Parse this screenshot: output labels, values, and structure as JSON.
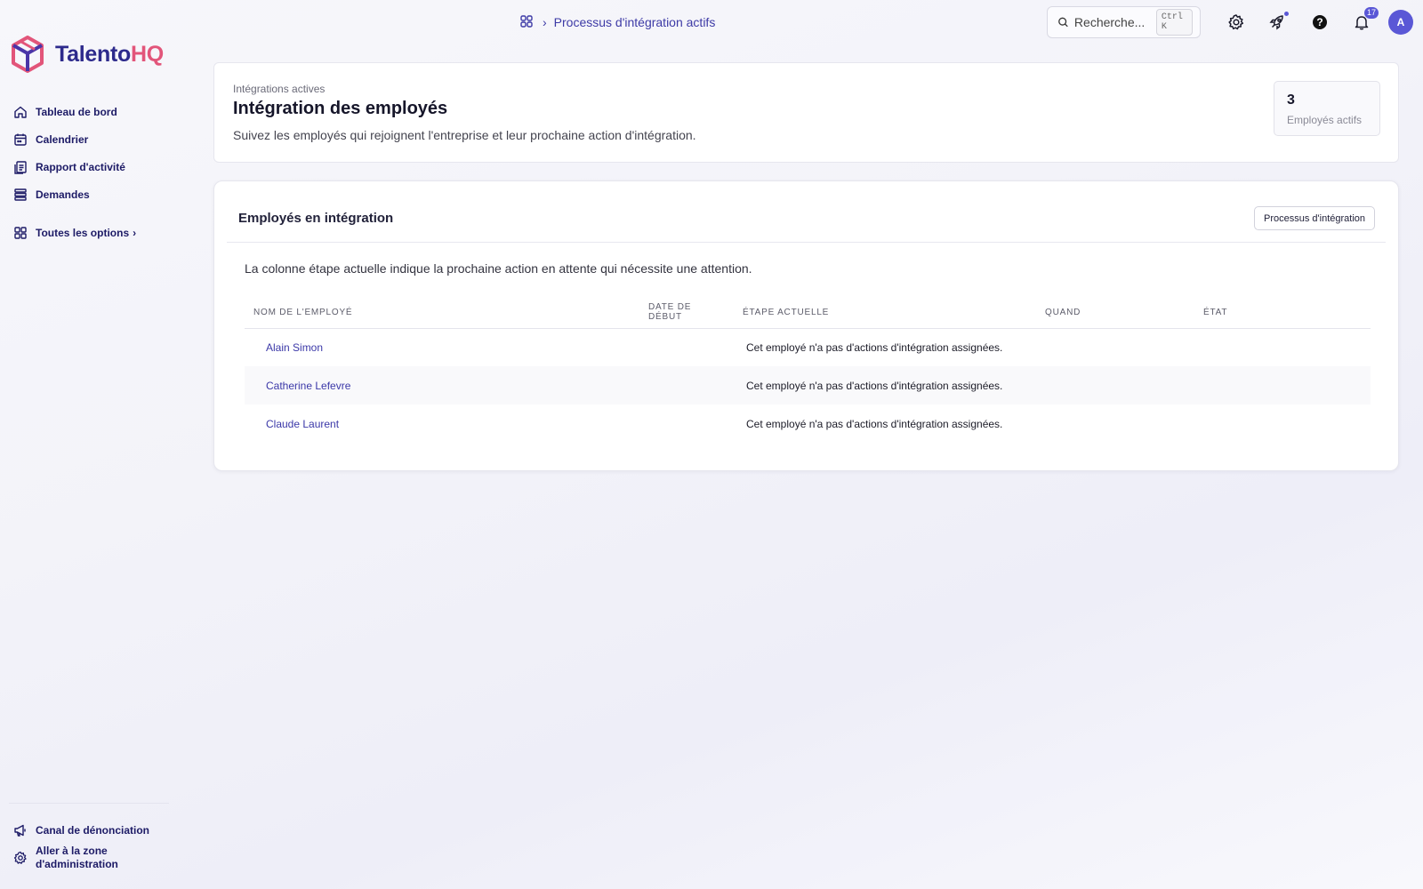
{
  "brand": {
    "name_part1": "Talento",
    "name_part2": "HQ",
    "colors": {
      "primary": "#2d2a8c",
      "accent": "#e2557a",
      "purple": "#5a57d6"
    }
  },
  "sidebar": {
    "items": [
      {
        "label": "Tableau de bord",
        "icon": "home-icon"
      },
      {
        "label": "Calendrier",
        "icon": "calendar-icon"
      },
      {
        "label": "Rapport d'activité",
        "icon": "report-icon"
      },
      {
        "label": "Demandes",
        "icon": "list-icon"
      },
      {
        "label": "Toutes les options",
        "icon": "grid-icon"
      }
    ],
    "bottom": [
      {
        "label": "Canal de dénonciation",
        "icon": "megaphone-icon"
      },
      {
        "label": "Aller à la zone d'administration",
        "icon": "gear-icon"
      }
    ]
  },
  "topbar": {
    "breadcrumb": "Processus d'intégration actifs",
    "search_placeholder": "Recherche...",
    "search_shortcut": "Ctrl K",
    "notifications_count": "17",
    "avatar_initial": "A"
  },
  "header": {
    "eyebrow": "Intégrations actives",
    "title": "Intégration des employés",
    "subtitle": "Suivez les employés qui rejoignent l'entreprise et leur prochaine action d'intégration.",
    "stat_value": "3",
    "stat_label": "Employés actifs"
  },
  "table_card": {
    "title": "Employés en intégration",
    "button": "Processus d'intégration",
    "note": "La colonne étape actuelle indique la prochaine action en attente qui nécessite une attention.",
    "columns": [
      "NOM DE L'EMPLOYÉ",
      "DATE DE DÉBUT",
      "ÉTAPE ACTUELLE",
      "QUAND",
      "ÉTAT"
    ],
    "rows": [
      {
        "name": "Alain Simon",
        "start": "",
        "step": "Cet employé n'a pas d'actions d'intégration assignées.",
        "when": "",
        "state": ""
      },
      {
        "name": "Catherine Lefevre",
        "start": "",
        "step": "Cet employé n'a pas d'actions d'intégration assignées.",
        "when": "",
        "state": ""
      },
      {
        "name": "Claude Laurent",
        "start": "",
        "step": "Cet employé n'a pas d'actions d'intégration assignées.",
        "when": "",
        "state": ""
      }
    ]
  }
}
